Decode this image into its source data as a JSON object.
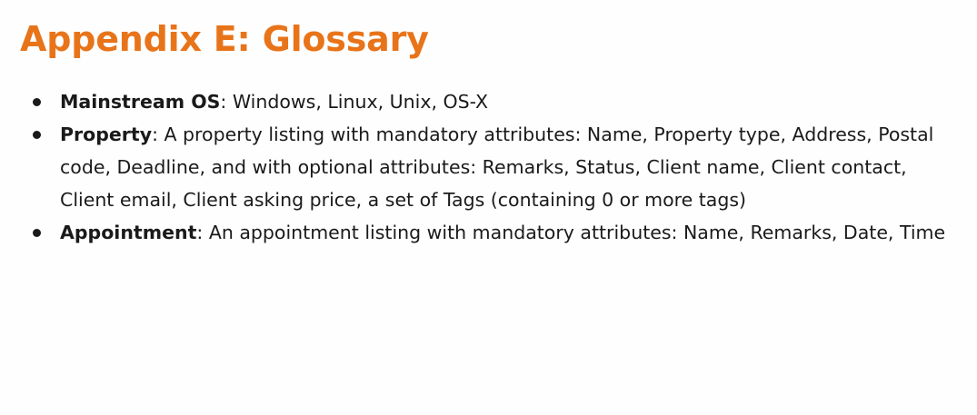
{
  "heading": {
    "title": "Appendix E: Glossary",
    "color": "#e8741a"
  },
  "glossary": {
    "items": [
      {
        "term": "Mainstream OS",
        "definition": ": Windows, Linux, Unix, OS-X"
      },
      {
        "term": "Property",
        "definition": ": A property listing with mandatory attributes: Name, Property type, Address, Postal code, Deadline, and with optional attributes: Remarks, Status, Client name, Client contact, Client email, Client asking price, a set of Tags (containing 0 or more tags)"
      },
      {
        "term": "Appointment",
        "definition": ": An appointment listing with mandatory attributes: Name, Remarks, Date, Time"
      }
    ]
  }
}
